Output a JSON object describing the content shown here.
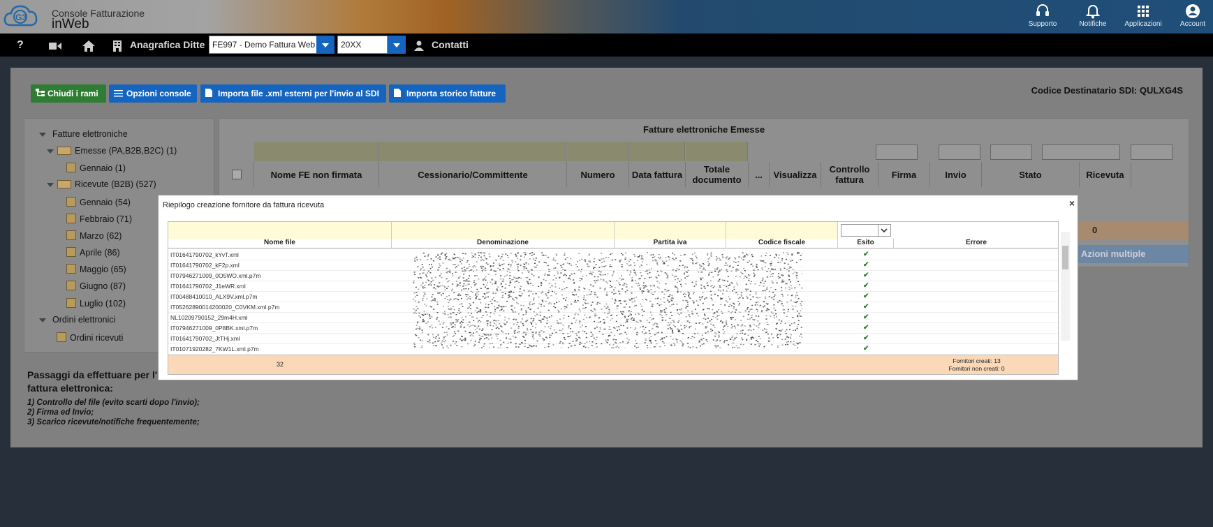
{
  "header": {
    "brand_line1": "Console Fatturazione",
    "brand_line2": "inWeb",
    "logo_text": "G3",
    "icons": [
      {
        "name": "supporto",
        "label": "Supporto",
        "icon": "headset-icon"
      },
      {
        "name": "notifiche",
        "label": "Notifiche",
        "icon": "bell-icon"
      },
      {
        "name": "applicazioni",
        "label": "Applicazioni",
        "icon": "grid-icon"
      },
      {
        "name": "account",
        "label": "Account",
        "icon": "user-circle-icon"
      }
    ]
  },
  "navbar": {
    "help": "?",
    "anagrafica": "Anagrafica Ditte",
    "company_select": "FE997 - Demo Fattura Web",
    "year_select": "20XX",
    "contatti": "Contatti"
  },
  "toolbar": {
    "chiudi": "Chiudi i rami",
    "opzioni": "Opzioni console",
    "importa_xml": "Importa file .xml esterni per l'invio al SDI",
    "importa_storico": "Importa storico fatture",
    "codice_sdi": "Codice Destinatario SDI: QULXG4S"
  },
  "tree": {
    "fatture": "Fatture elettroniche",
    "emesse": "Emesse (PA,B2B,B2C) (1)",
    "emesse_children": [
      "Gennaio (1)"
    ],
    "ricevute": "Ricevute (B2B) (527)",
    "ricevute_children": [
      "Gennaio (54)",
      "Febbraio (71)",
      "Marzo (62)",
      "Aprile (86)",
      "Maggio (65)",
      "Giugno (87)",
      "Luglio (102)"
    ],
    "ordini": "Ordini elettronici",
    "ordini_children": [
      "Ordini ricevuti"
    ]
  },
  "grid": {
    "title": "Fatture elettroniche Emesse",
    "columns": [
      "Nome FE non firmata",
      "Cessionario/Committente",
      "Numero",
      "Data fattura",
      "Totale documento",
      "...",
      "Visualizza",
      "Controllo fattura",
      "Firma",
      "Invio",
      "Stato",
      "Ricevuta"
    ],
    "ricevuta_value": "0",
    "azioni_multiple": "Azioni multiple"
  },
  "steps": {
    "title_a": "Passaggi da effettuare per l'i",
    "title_b": "fattura elettronica:",
    "items": [
      "1) Controllo del file (evito scarti dopo l'invio);",
      "2) Firma ed Invio;",
      "3) Scarico ricevute/notifiche frequentemente;"
    ]
  },
  "modal": {
    "title": "Riepilogo creazione fornitore da fattura ricevuta",
    "close": "×",
    "columns": [
      "Nome file",
      "Denominazione",
      "Partita iva",
      "Codice fiscale",
      "Esito",
      "Errore"
    ],
    "rows": [
      "IT01641790702_kYvT.xml",
      "IT01641790702_kF2p.xml",
      "IT07946271009_0O5WO.xml.p7m",
      "IT01641790702_J1eWR.xml",
      "IT00488410010_ALX9V.xml.p7m",
      "IT05262890014200020_C0VKM.xml.p7m",
      "NL10209790152_29m4H.xml",
      "IT07946271009_0P8BK.xml.p7m",
      "IT01641790702_JtTHj.xml",
      "IT01071920282_7KW1L.xml.p7m"
    ],
    "esito_symbol": "✔",
    "footer_count": "32",
    "footer_creati": "Fornitori creati: 13",
    "footer_non_creati": "Fornitori non creati: 0"
  },
  "colors": {
    "nav_bg": "#000000",
    "btn_green": "#2e7d32",
    "btn_blue": "#1565c0",
    "filter_yellow": "#fffbd7",
    "footer_orange": "#fbd8b8"
  }
}
